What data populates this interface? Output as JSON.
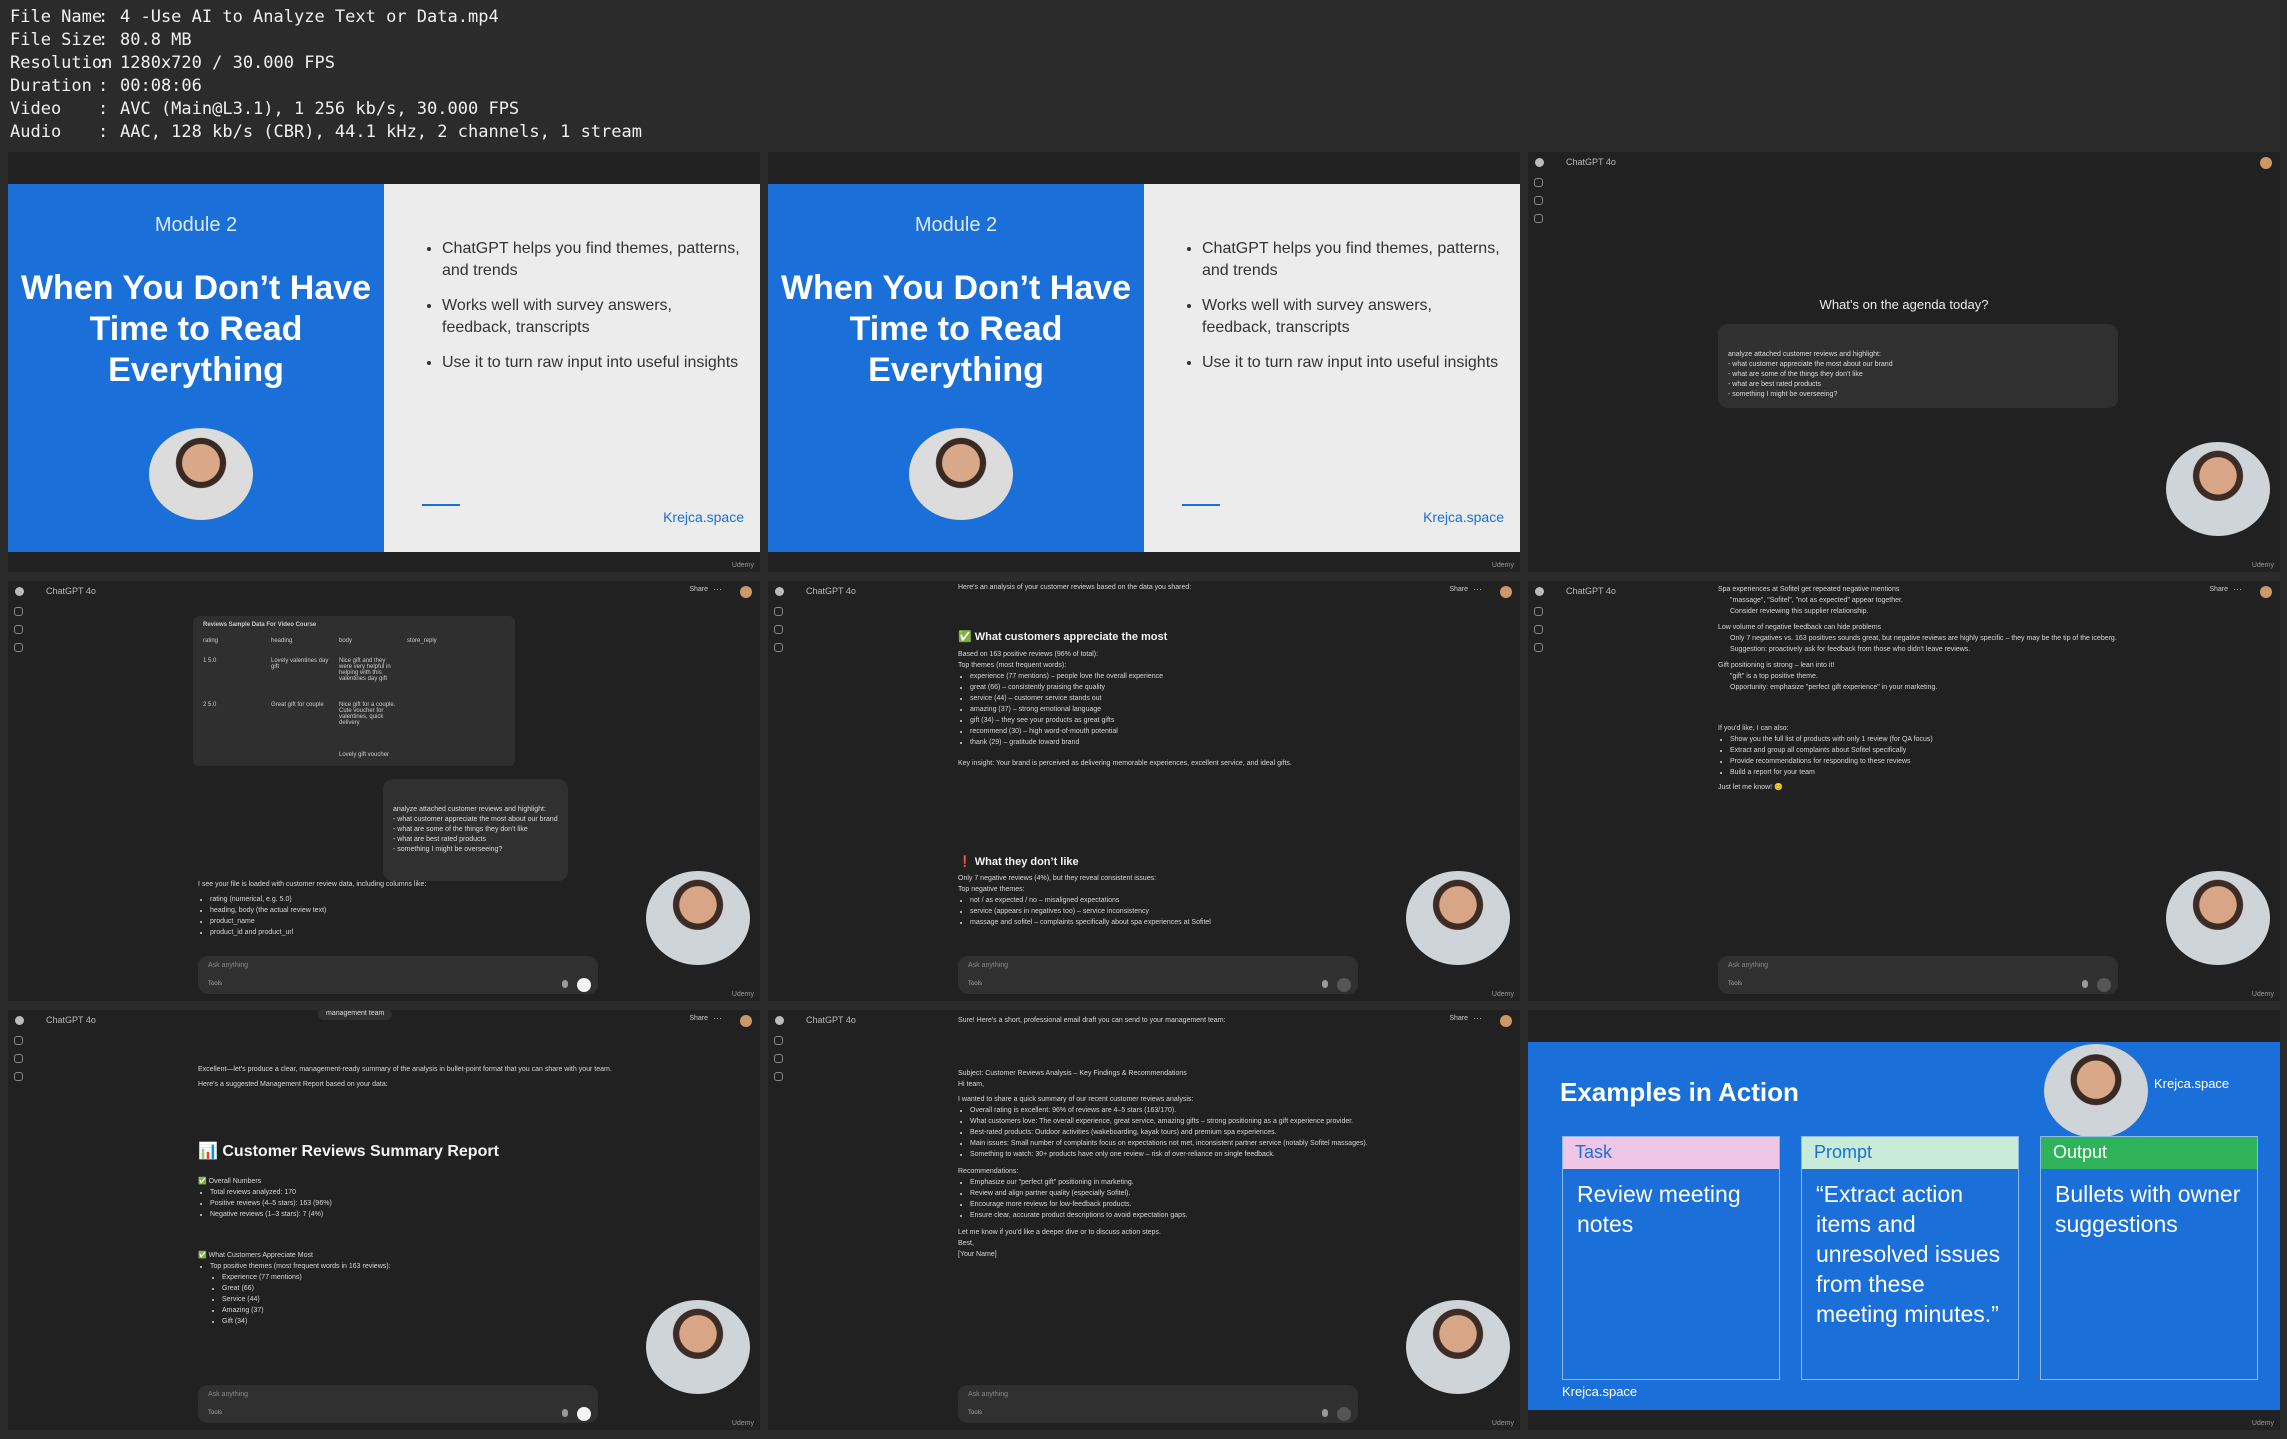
{
  "info": [
    {
      "key": "File Name",
      "value": "4 -Use AI to Analyze Text or Data.mp4"
    },
    {
      "key": "File Size",
      "value": "80.8 MB"
    },
    {
      "key": "Resolution",
      "value": "1280x720 / 30.000 FPS"
    },
    {
      "key": "Duration",
      "value": "00:08:06"
    },
    {
      "key": "Video",
      "value": "AVC (Main@L3.1), 1 256 kb/s, 30.000 FPS"
    },
    {
      "key": "Audio",
      "value": "AAC, 128 kb/s (CBR), 44.1 kHz, 2 channels, 1 stream"
    }
  ],
  "info_sep": ":",
  "watermark": "Udemy",
  "slide": {
    "module": "Module 2",
    "title": "When You Don’t Have Time to Read Everything",
    "bullets": [
      "ChatGPT helps you find themes, patterns, and trends",
      "Works well with survey answers, feedback, transcripts",
      "Use it to turn raw input into useful insights"
    ],
    "brand": "Krejca.space"
  },
  "chat": {
    "model": "ChatGPT 4o",
    "share": "Share",
    "placeholder": "Ask anything",
    "tools": "Tools",
    "agenda_question": "What’s on the agenda today?",
    "prompt": "analyze attached customer reviews and highlight:\n- what customer appreciate the most about our brand\n- what are some of the things they don't like\n- what are best rated products\n- something I might be overseeing?"
  },
  "table": {
    "title": "Reviews Sample Data For Video Course",
    "headers": [
      "rating",
      "heading",
      "body",
      "store_reply"
    ],
    "rows": [
      [
        "1  5.0",
        "Lovely valentines day gift",
        "Nice gift and they were very helpful in helping with this valentines day gift",
        ""
      ],
      [
        "2  5.0",
        "Great gift for couple",
        "Nice gift for a couple. Cute voucher for valentines, quick delivery",
        ""
      ]
    ],
    "partial": "Lovely gift voucher"
  },
  "t4": {
    "intro": "I see your file is loaded with customer review data, including columns like:",
    "items": [
      "rating (numerical, e.g. 5.0)",
      "heading, body (the actual review text)",
      "product_name",
      "product_id and product_url"
    ]
  },
  "t5": {
    "intro": "Here's an analysis of your customer reviews based on the data you shared:",
    "h1": "✅ What customers appreciate the most",
    "based": "Based on 163 positive reviews (96% of total):",
    "themes_label": "Top themes (most frequent words):",
    "themes": [
      "experience (77 mentions) – people love the overall experience",
      "great (66) – consistently praising the quality",
      "service (44) – customer service stands out",
      "amazing (37) – strong emotional language",
      "gift (34) – they see your products as great gifts",
      "recommend (30) – high word-of-mouth potential",
      "thank (29) – gratitude toward brand"
    ],
    "insight": "Key insight: Your brand is perceived as delivering memorable experiences, excellent service, and ideal gifts.",
    "h2": "❗ What they don’t like",
    "neg": "Only 7 negative reviews (4%), but they reveal consistent issues:",
    "neg_label": "Top negative themes:",
    "neg_items": [
      "not / as expected / no – misaligned expectations",
      "service (appears in negatives too) – service inconsistency",
      "massage and sofitel – complaints specifically about spa experiences at Sofitel"
    ]
  },
  "t6": {
    "items": [
      "Spa experiences at Sofitel get repeated negative mentions",
      "\"massage\", \"Sofitel\", \"not as expected\" appear together.",
      "Consider reviewing this supplier relationship.",
      "Low volume of negative feedback can hide problems",
      "Only 7 negatives vs. 163 positives sounds great, but negative reviews are highly specific – they may be the tip of the iceberg.",
      "Suggestion: proactively ask for feedback from those who didn't leave reviews.",
      "Gift positioning is strong – lean into it!",
      "\"gift\" is a top positive theme.",
      "Opportunity: emphasize \"perfect gift experience\" in your marketing."
    ],
    "offer": "If you'd like, I can also:",
    "offers": [
      "Show you the full list of products with only 1 review (for QA focus)",
      "Extract and group all complaints about Sofitel specifically",
      "Provide recommendations for responding to these reviews",
      "Build a report for your team"
    ],
    "close": "Just let me know! 😊"
  },
  "t7": {
    "top": "management team",
    "intro": "Excellent—let's produce a clear, management-ready summary of the analysis in bullet-point format that you can share with your team.",
    "intro2": "Here's a suggested Management Report based on your data:",
    "title": "📊 Customer Reviews Summary Report",
    "s1": "✅ Overall Numbers",
    "s1_items": [
      "Total reviews analyzed: 170",
      "Positive reviews (4–5 stars): 163 (96%)",
      "Negative reviews (1–3 stars): 7 (4%)"
    ],
    "s2": "✅ What Customers Appreciate Most",
    "s2_lead": "Top positive themes (most frequent words in 163 reviews):",
    "s2_items": [
      "Experience (77 mentions)",
      "Great (66)",
      "Service (44)",
      "Amazing (37)",
      "Gift (34)"
    ]
  },
  "t8": {
    "intro": "Sure! Here's a short, professional email draft you can send to your management team:",
    "subject": "Subject: Customer Reviews Analysis – Key Findings & Recommendations",
    "hi": "Hi team,",
    "lead": "I wanted to share a quick summary of our recent customer reviews analysis:",
    "items": [
      "Overall rating is excellent: 96% of reviews are 4–5 stars (163/170).",
      "What customers love: The overall experience, great service, amazing gifts – strong positioning as a gift experience provider.",
      "Best-rated products: Outdoor activities (wakeboarding, kayak tours) and premium spa experiences.",
      "Main issues: Small number of complaints focus on expectations not met, inconsistent partner service (notably Sofitel massages).",
      "Something to watch: 30+ products have only one review – risk of over-reliance on single feedback."
    ],
    "rec": "Recommendations:",
    "recs": [
      "Emphasize our \"perfect gift\" positioning in marketing.",
      "Review and align partner quality (especially Sofitel).",
      "Encourage more reviews for low-feedback products.",
      "Ensure clear, accurate product descriptions to avoid expectation gaps."
    ],
    "close": "Let me know if you'd like a deeper dive or to discuss action steps.",
    "best": "Best,",
    "name": "[Your Name]"
  },
  "examples": {
    "title": "Examples in Action",
    "brand": "Krejca.space",
    "cards": [
      {
        "header": "Task",
        "body": "Review meeting notes",
        "color": "#f0c6e6"
      },
      {
        "header": "Prompt",
        "body": "“Extract action items and unresolved issues from these meeting minutes.”",
        "color": "#c9ecd9"
      },
      {
        "header": "Output",
        "body": "Bullets with owner suggestions",
        "color": "#2fb35a"
      }
    ]
  }
}
